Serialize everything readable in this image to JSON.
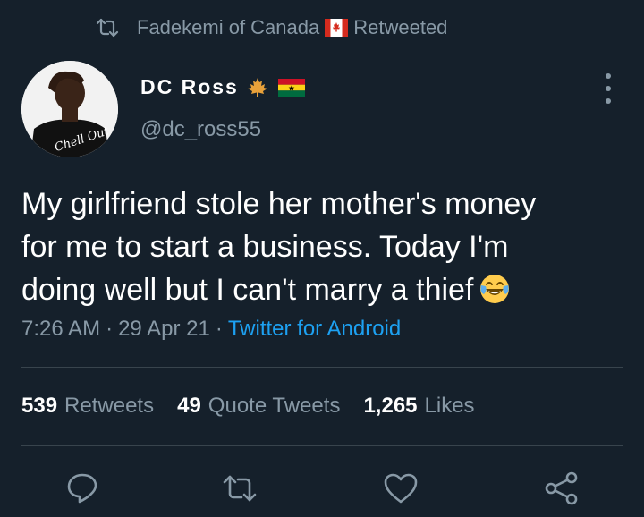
{
  "retweet_context": {
    "user": "Fadekemi of Canada",
    "action": "Retweeted",
    "icon": "retweet-icon",
    "flag": "canada-flag-icon"
  },
  "author": {
    "name": "DC Ross",
    "handle": "@dc_ross55",
    "avatar_text": "Chell Out",
    "badges": [
      "maple-leaf-icon",
      "ghana-flag-icon"
    ]
  },
  "tweet": {
    "text_lines": [
      "My girlfriend stole her mother's money",
      "for me to start a business. Today I'm",
      "doing well but I can't marry a thief"
    ],
    "emoji": "face-with-tears-of-joy-icon"
  },
  "meta": {
    "time": "7:26 AM",
    "separator": "·",
    "date": "29 Apr 21",
    "source": "Twitter for Android"
  },
  "stats": [
    {
      "count": "539",
      "label": "Retweets"
    },
    {
      "count": "49",
      "label": "Quote Tweets"
    },
    {
      "count": "1,265",
      "label": "Likes"
    }
  ],
  "actions": [
    "reply-icon",
    "retweet-icon",
    "like-icon",
    "share-icon"
  ],
  "colors": {
    "background": "#15202b",
    "secondary_text": "#8899a6",
    "link": "#1da1f2",
    "divider": "#38444d",
    "text": "#ffffff"
  }
}
